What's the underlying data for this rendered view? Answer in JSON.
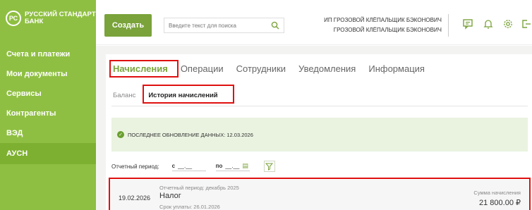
{
  "brand": {
    "logo_mark": "РС",
    "name_line1": "Русский Стандарт",
    "name_line2": "Банк"
  },
  "sidebar": {
    "items": [
      {
        "label": "Счета и платежи",
        "active": false
      },
      {
        "label": "Мои документы",
        "active": false
      },
      {
        "label": "Сервисы",
        "active": false
      },
      {
        "label": "Контрагенты",
        "active": false
      },
      {
        "label": "ВЭД",
        "active": false
      },
      {
        "label": "АУСН",
        "active": true
      }
    ]
  },
  "header": {
    "create_label": "Создать",
    "search_placeholder": "Введите текст для поиска",
    "user_line1": "ИП ГРОЗОВОЙ КЛЁПАЛЬЩИК БЭКОНОВИЧ",
    "user_line2": "ГРОЗОВОЙ КЛЁПАЛЬЩИК БЭКОНОВИЧ",
    "icons": [
      "chat-icon",
      "bell-icon",
      "gear-icon",
      "logout-icon"
    ]
  },
  "tabs": [
    {
      "label": "Начисления",
      "active": true
    },
    {
      "label": "Операции",
      "active": false
    },
    {
      "label": "Сотрудники",
      "active": false
    },
    {
      "label": "Уведомления",
      "active": false
    },
    {
      "label": "Информация",
      "active": false
    }
  ],
  "subtabs": [
    {
      "label": "Баланс",
      "active": false
    },
    {
      "label": "История начислений",
      "active": true
    }
  ],
  "notice": {
    "text": "ПОСЛЕДНЕЕ ОБНОВЛЕНИЕ ДАННЫХ: 12.03.2026"
  },
  "filter": {
    "label": "Отчетный период:",
    "from_label": "с",
    "from_value": "__.__",
    "to_label": "по",
    "to_value": "__.__"
  },
  "accrual": {
    "date": "19.02.2026",
    "period": "Отчетный период: декабрь 2025",
    "title": "Налог",
    "due": "Срок уплаты: 26.01.2026",
    "amount_label": "Сумма начисления",
    "amount": "21 800.00 ₽"
  },
  "colors": {
    "brand_green": "#8fbf42",
    "accent": "#7aa33b",
    "highlight": "#e01010"
  }
}
